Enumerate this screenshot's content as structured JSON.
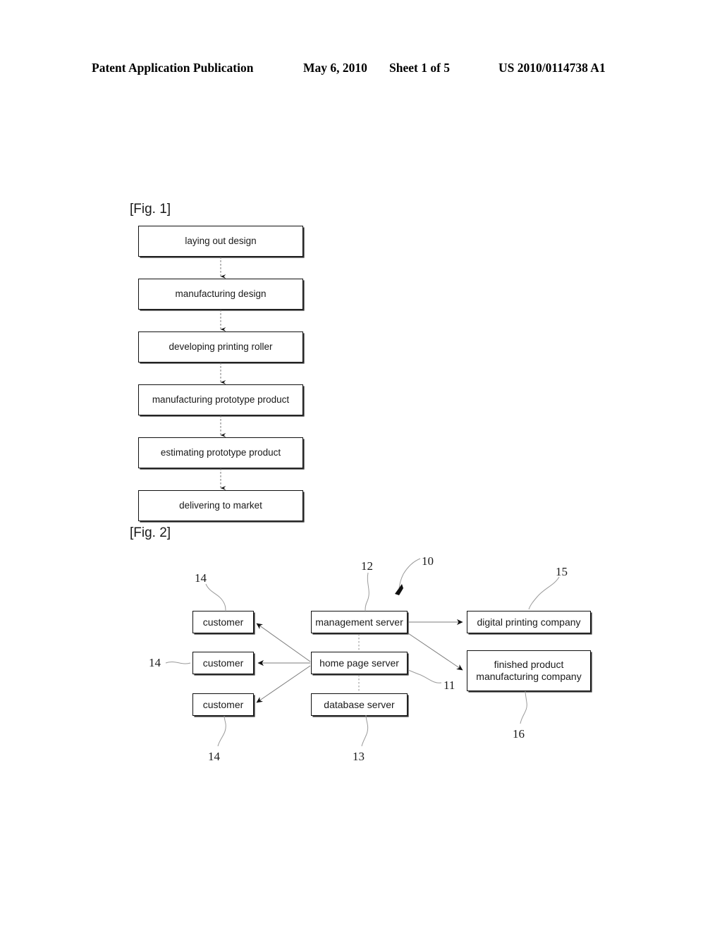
{
  "header": {
    "publication": "Patent Application Publication",
    "date": "May 6, 2010",
    "sheet": "Sheet 1 of 5",
    "patent_number": "US 2010/0114738 A1"
  },
  "figures": [
    {
      "caption": "[Fig. 1]",
      "type": "vertical-flowchart",
      "steps": [
        {
          "label": "laying out design"
        },
        {
          "label": "manufacturing design"
        },
        {
          "label": "developing printing roller"
        },
        {
          "label": "manufacturing prototype product"
        },
        {
          "label": "estimating prototype product"
        },
        {
          "label": "delivering to market"
        }
      ]
    },
    {
      "caption": "[Fig. 2]",
      "type": "system-block-diagram",
      "nodes": [
        {
          "id": "customer1",
          "label": "customer"
        },
        {
          "id": "customer2",
          "label": "customer"
        },
        {
          "id": "customer3",
          "label": "customer"
        },
        {
          "id": "management",
          "label": "management server"
        },
        {
          "id": "homepage",
          "label": "home page server"
        },
        {
          "id": "database",
          "label": "database server"
        },
        {
          "id": "printing",
          "label": "digital printing company"
        },
        {
          "id": "finished_line1",
          "label": "finished product"
        },
        {
          "id": "finished_line2",
          "label": "manufacturing company"
        }
      ],
      "reference_numerals": [
        {
          "id": "ref-10",
          "value": "10"
        },
        {
          "id": "ref-11",
          "value": "11"
        },
        {
          "id": "ref-12",
          "value": "12"
        },
        {
          "id": "ref-13",
          "value": "13"
        },
        {
          "id": "ref-14a",
          "value": "14"
        },
        {
          "id": "ref-14b",
          "value": "14"
        },
        {
          "id": "ref-14c",
          "value": "14"
        },
        {
          "id": "ref-15",
          "value": "15"
        },
        {
          "id": "ref-16",
          "value": "16"
        }
      ]
    }
  ],
  "colors": {
    "ink": "#111111",
    "paper": "#ffffff",
    "leader": "#8a8a8a"
  }
}
